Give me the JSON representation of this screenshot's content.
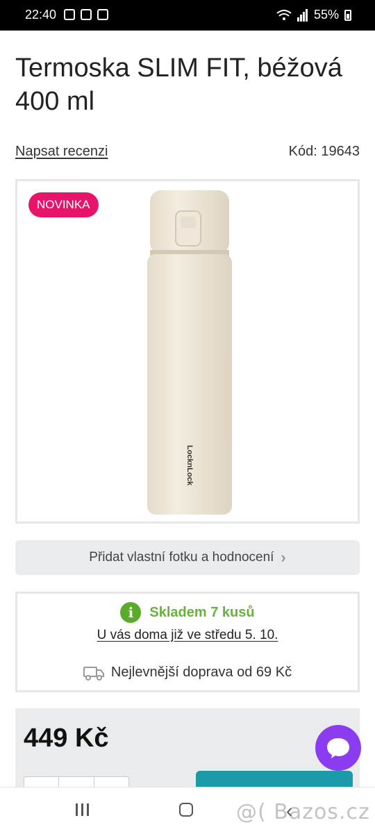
{
  "status_bar": {
    "time": "22:40",
    "battery": "55%"
  },
  "product": {
    "title": "Termoska SLIM FIT, béžová 400 ml",
    "review_link": "Napsat recenzi",
    "code": "Kód: 19643",
    "badge": "NOVINKA",
    "bottle_brand": "LocknLock",
    "add_photo_button": "Přidat vlastní fotku a hodnocení",
    "stock": {
      "status": "Skladem 7 kusů",
      "delivery": "U vás doma již ve středu 5. 10.",
      "shipping": "Nejlevnější doprava od 69 Kč"
    },
    "price": "449 Kč"
  },
  "watermark": "@( Bazos.cz",
  "colors": {
    "accent_pink": "#e8136b",
    "stock_green": "#67b23c",
    "chat_purple": "#8b3cf0",
    "cart_teal": "#1b9aaa"
  },
  "icons": [
    "wifi-icon",
    "signal-icon",
    "battery-icon",
    "info-icon",
    "truck-icon",
    "chat-icon",
    "chevron-right-icon",
    "recent-apps-icon",
    "home-icon",
    "back-icon"
  ]
}
